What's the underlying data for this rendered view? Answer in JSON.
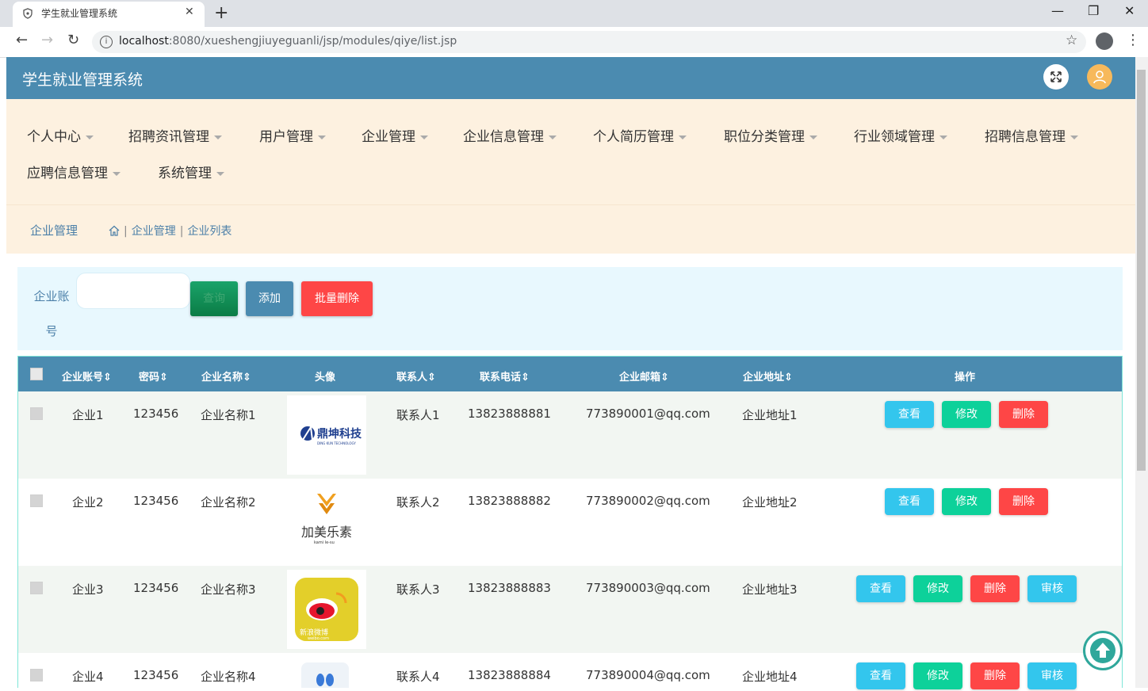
{
  "browser": {
    "tab_title": "学生就业管理系统",
    "url_host": "localhost",
    "url_rest": ":8080/xueshengjiuyeguanli/jsp/modules/qiye/list.jsp"
  },
  "app": {
    "title": "学生就业管理系统",
    "colors": {
      "header": "#4b8bb0",
      "nav_bg": "#fdf1e0",
      "add": "#4b8bb0",
      "delete": "#fe4646",
      "view": "#33c6ed",
      "edit": "#0dd19a"
    }
  },
  "nav": {
    "items": [
      "个人中心",
      "招聘资讯管理",
      "用户管理",
      "企业管理",
      "企业信息管理",
      "个人简历管理",
      "职位分类管理",
      "行业领域管理",
      "招聘信息管理",
      "应聘信息管理",
      "系统管理"
    ]
  },
  "breadcrumb": {
    "title": "企业管理",
    "path": [
      "企业管理",
      "企业列表"
    ]
  },
  "search": {
    "label_line1": "企业账",
    "label_line2": "号",
    "input_value": "",
    "query_label": "查询",
    "add_label": "添加",
    "batch_delete_label": "批量删除"
  },
  "table": {
    "headers": [
      "企业账号",
      "密码",
      "企业名称",
      "头像",
      "联系人",
      "联系电话",
      "企业邮箱",
      "企业地址",
      "操作"
    ],
    "rows": [
      {
        "account": "企业1",
        "password": "123456",
        "name": "企业名称1",
        "avatar": "鼎坤科技 logo",
        "contact": "联系人1",
        "phone": "13823888881",
        "email": "773890001@qq.com",
        "address": "企业地址1",
        "has_audit": false
      },
      {
        "account": "企业2",
        "password": "123456",
        "name": "企业名称2",
        "avatar": "加美乐素 logo",
        "contact": "联系人2",
        "phone": "13823888882",
        "email": "773890002@qq.com",
        "address": "企业地址2",
        "has_audit": false
      },
      {
        "account": "企业3",
        "password": "123456",
        "name": "企业名称3",
        "avatar": "新浪微博 logo",
        "contact": "联系人3",
        "phone": "13823888883",
        "email": "773890003@qq.com",
        "address": "企业地址3",
        "has_audit": true
      },
      {
        "account": "企业4",
        "password": "123456",
        "name": "企业名称4",
        "avatar": "logo",
        "contact": "联系人4",
        "phone": "13823888884",
        "email": "773890004@qq.com",
        "address": "企业地址4",
        "has_audit": true
      }
    ],
    "action_labels": {
      "view": "查看",
      "edit": "修改",
      "delete": "删除",
      "audit": "审核"
    }
  },
  "logos": {
    "dingkun": {
      "cn": "鼎坤科技",
      "en": "DING KUN TECHNOLOGY"
    },
    "jiamei": {
      "cn": "加美乐素",
      "en": "kami le-su"
    },
    "weibo": {
      "cn": "新浪微博",
      "en": "weibo.com"
    }
  }
}
